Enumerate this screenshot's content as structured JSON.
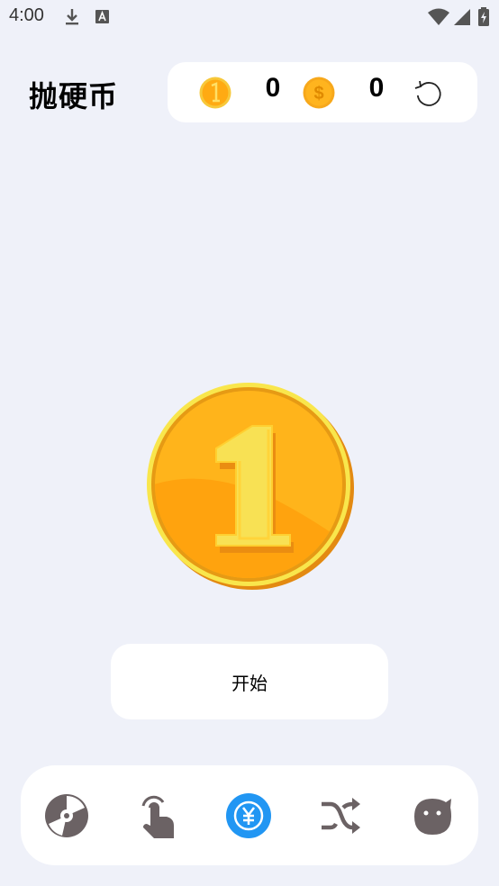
{
  "status_bar": {
    "time": "4:00",
    "icons": [
      "download-icon",
      "text-a-icon",
      "wifi-icon",
      "signal-icon",
      "battery-icon"
    ]
  },
  "header": {
    "title": "抛硬币"
  },
  "scoreboard": {
    "heads_coin_icon": "coin-one-icon",
    "heads_count": "0",
    "tails_coin_icon": "coin-dollar-icon",
    "tails_count": "0",
    "reset_icon": "refresh-icon"
  },
  "main": {
    "coin_face": "1",
    "start_label": "开始"
  },
  "bottom_nav": {
    "items": [
      {
        "icon": "disc-icon",
        "active": false
      },
      {
        "icon": "tap-hand-icon",
        "active": false
      },
      {
        "icon": "yuan-coin-icon",
        "active": true
      },
      {
        "icon": "shuffle-icon",
        "active": false
      },
      {
        "icon": "cat-face-icon",
        "active": false
      }
    ]
  },
  "colors": {
    "background": "#eff1f9",
    "card": "#ffffff",
    "coin_gold": "#ffb11b",
    "coin_rim": "#f7e24e",
    "nav_active": "#2196f3",
    "nav_icon": "#6b6264"
  }
}
